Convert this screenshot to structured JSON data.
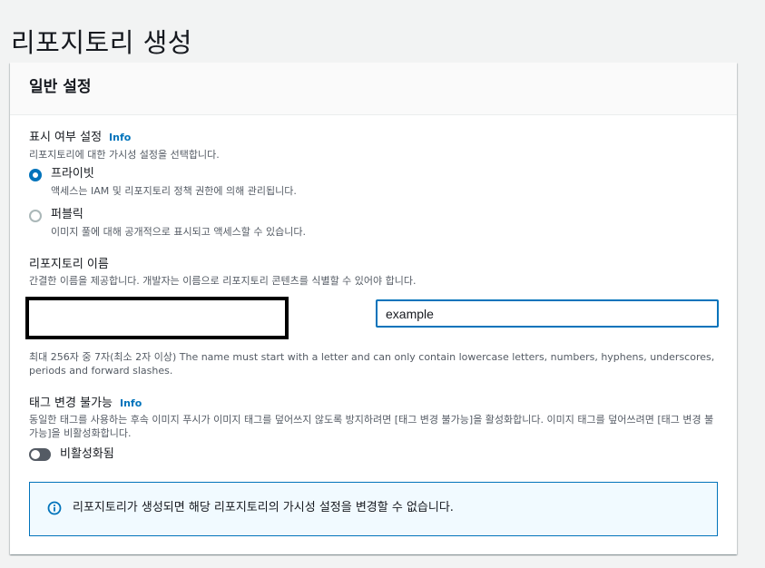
{
  "page": {
    "title": "리포지토리 생성"
  },
  "section": {
    "title": "일반 설정"
  },
  "visibility": {
    "label": "표시 여부 설정",
    "info": "Info",
    "description": "리포지토리에 대한 가시성 설정을 선택합니다.",
    "options": [
      {
        "label": "프라이빗",
        "description": "액세스는 IAM 및 리포지토리 정책 권한에 의해 관리됩니다.",
        "selected": true
      },
      {
        "label": "퍼블릭",
        "description": "이미지 풀에 대해 공개적으로 표시되고 액세스할 수 있습니다.",
        "selected": false
      }
    ]
  },
  "repo_name": {
    "label": "리포지토리 이름",
    "description": "간결한 이름을 제공합니다. 개발자는 이름으로 리포지토리 콘텐츠를 식별할 수 있어야 합니다.",
    "value": "example",
    "constraint": "최대 256자 중 7자(최소 2자 이상) The name must start with a letter and can only contain lowercase letters, numbers, hyphens, underscores, periods and forward slashes."
  },
  "tag_immutability": {
    "label": "태그 변경 불가능",
    "info": "Info",
    "description": "동일한 태그를 사용하는 후속 이미지 푸시가 이미지 태그를 덮어쓰지 않도록 방지하려면 [태그 변경 불가능]을 활성화합니다. 이미지 태그를 덮어쓰려면 [태그 변경 불가능]을 비활성화합니다.",
    "toggle_label": "비활성화됨",
    "enabled": false
  },
  "alert": {
    "text": "리포지토리가 생성되면 해당 리포지토리의 가시성 설정을 변경할 수 없습니다."
  },
  "colors": {
    "accent": "#0073bb",
    "page_background": "#f2f3f3",
    "text": "#16191f",
    "secondary_text": "#545b64",
    "alert_background": "#f1faff"
  }
}
